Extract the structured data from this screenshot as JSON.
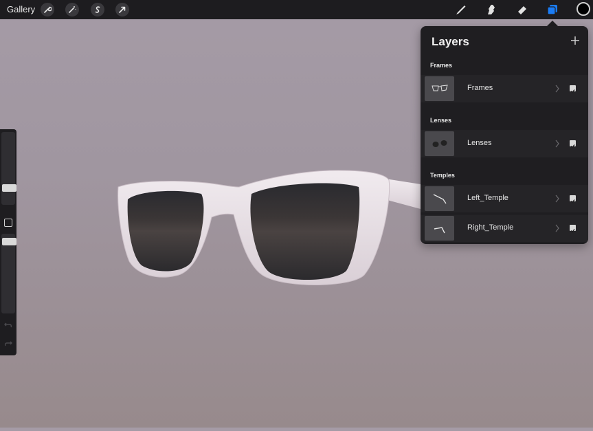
{
  "toolbar": {
    "gallery_label": "Gallery",
    "left_tools": [
      "wrench-icon",
      "magic-wand-icon",
      "selection-icon",
      "transform-arrow-icon"
    ],
    "right_tools": [
      "brush-icon",
      "smudge-icon",
      "eraser-icon",
      "layers-icon"
    ],
    "active_tool": "layers-icon",
    "accent_color": "#1a7cf5",
    "current_color": "#000000"
  },
  "sidebar": {
    "tools": [
      "brush-size-slider",
      "modify-button",
      "opacity-slider",
      "undo-icon",
      "redo-icon"
    ]
  },
  "layers_panel": {
    "title": "Layers",
    "add_icon": "plus-icon",
    "groups": [
      {
        "label": "Frames",
        "layers": [
          {
            "name": "Frames",
            "visible": true
          }
        ]
      },
      {
        "label": "Lenses",
        "layers": [
          {
            "name": "Lenses",
            "visible": true
          }
        ]
      },
      {
        "label": "Temples",
        "layers": [
          {
            "name": "Left_Temple",
            "visible": true
          },
          {
            "name": "Right_Temple",
            "visible": true
          }
        ]
      }
    ]
  },
  "canvas": {
    "subject": "sunglasses-3d-model"
  }
}
